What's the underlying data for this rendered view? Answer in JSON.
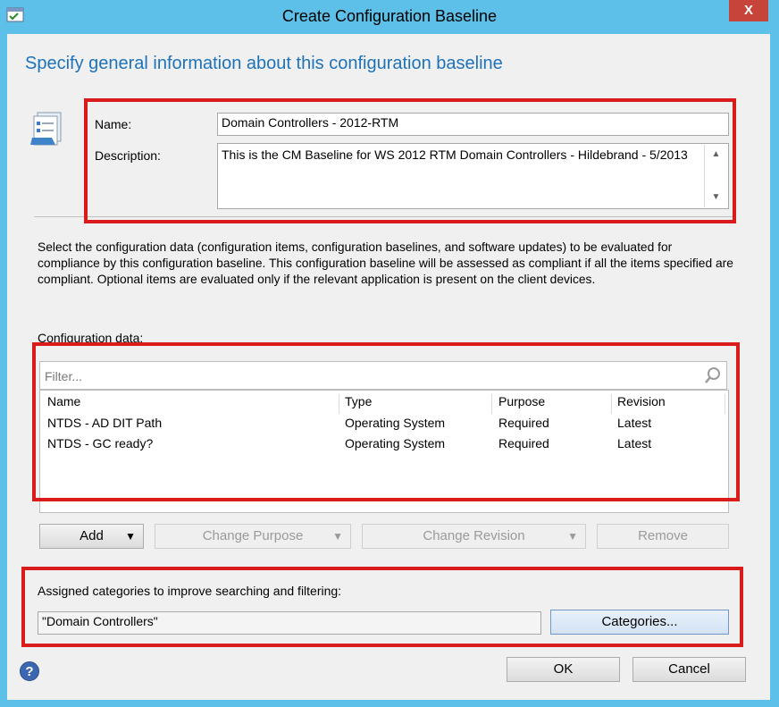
{
  "window": {
    "title": "Create Configuration Baseline",
    "close_glyph": "X"
  },
  "header": "Specify general information about this configuration baseline",
  "form": {
    "name_label": "Name:",
    "name_value": "Domain Controllers - 2012-RTM",
    "description_label": "Description:",
    "description_value": "This is the CM Baseline for WS 2012 RTM Domain Controllers - Hildebrand - 5/2013"
  },
  "instructions": "Select the configuration data (configuration items, configuration baselines, and software updates) to be evaluated for compliance by this configuration baseline. This configuration baseline will be assessed as compliant if all the items specified are compliant. Optional items are evaluated only if the relevant application is present on  the client devices.",
  "config_data": {
    "label": "Configuration data:",
    "filter_placeholder": "Filter...",
    "columns": [
      "Name",
      "Type",
      "Purpose",
      "Revision"
    ],
    "rows": [
      [
        "NTDS - AD DIT Path",
        "Operating System",
        "Required",
        "Latest"
      ],
      [
        "NTDS - GC ready?",
        "Operating System",
        "Required",
        "Latest"
      ]
    ]
  },
  "buttons": {
    "add": "Add",
    "change_purpose": "Change Purpose",
    "change_revision": "Change Revision",
    "remove": "Remove",
    "categories": "Categories...",
    "ok": "OK",
    "cancel": "Cancel"
  },
  "categories": {
    "label": "Assigned categories to improve searching and filtering:",
    "value": "\"Domain Controllers\""
  },
  "icons": {
    "window": "configuration-baseline-icon",
    "wizard": "checklist-icon",
    "search": "search-icon",
    "help": "help-icon",
    "help_glyph": "?"
  },
  "colors": {
    "title_bar": "#5cc0e8",
    "header_text": "#1e72b8",
    "annotation_red": "#d91b1b"
  }
}
